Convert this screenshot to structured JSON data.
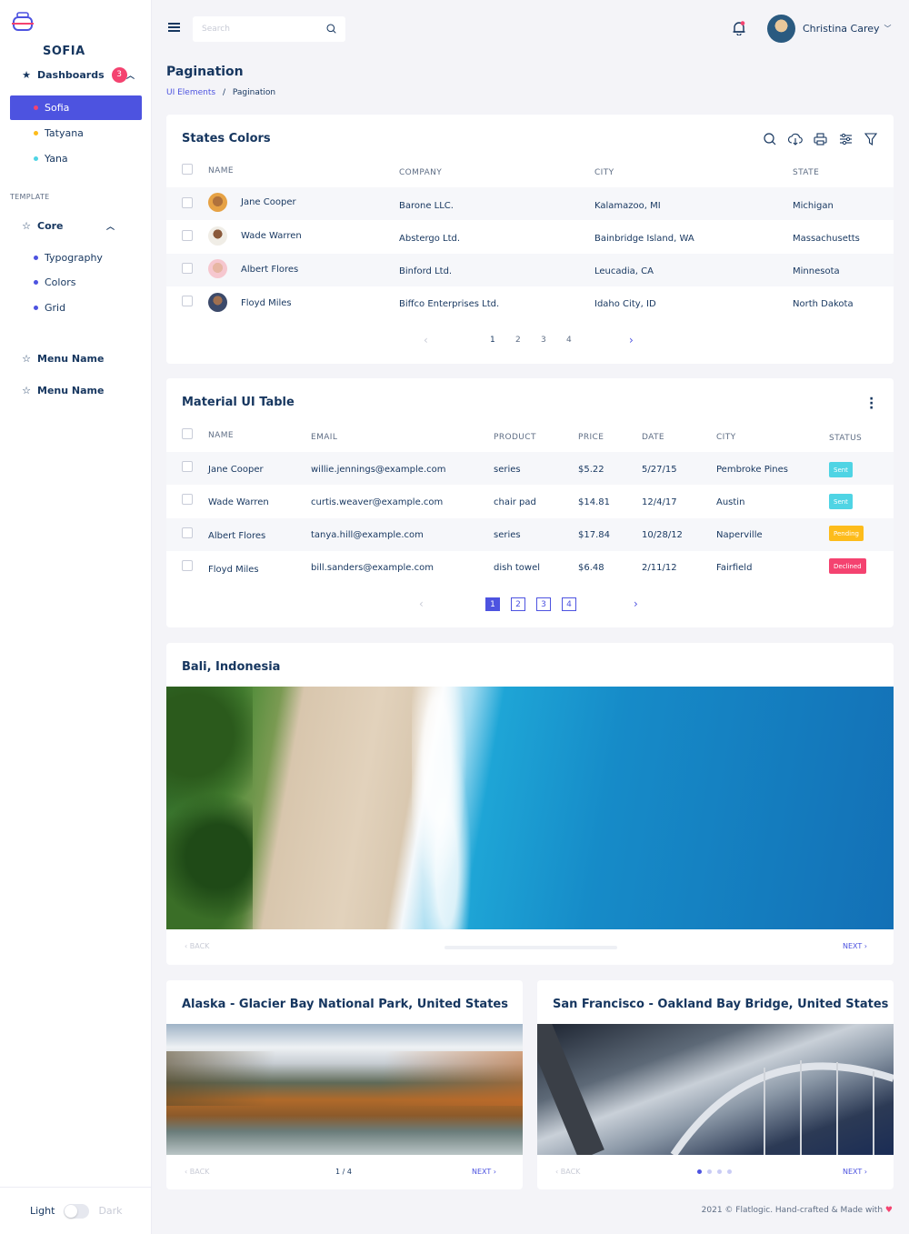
{
  "sidebar": {
    "brand": "SOFIA",
    "dashboards_label": "Dashboards",
    "dashboards_badge": "3",
    "dashboards_items": [
      {
        "label": "Sofia",
        "dot": "#f44370"
      },
      {
        "label": "Tatyana",
        "dot": "#fdbc1b"
      },
      {
        "label": "Yana",
        "dot": "#4fd4e4"
      }
    ],
    "template_label": "TEMPLATE",
    "core_label": "Core",
    "core_items": [
      {
        "label": "Typography",
        "dot": "#4d53e0"
      },
      {
        "label": "Colors",
        "dot": "#4d53e0"
      },
      {
        "label": "Grid",
        "dot": "#4d53e0"
      }
    ],
    "menu_items": [
      "Menu Name",
      "Menu Name"
    ],
    "theme_light": "Light",
    "theme_dark": "Dark"
  },
  "header": {
    "search_placeholder": "Search",
    "user_name": "Christina Carey"
  },
  "page": {
    "title": "Pagination",
    "breadcrumb_parent": "UI Elements",
    "breadcrumb_sep": "/",
    "breadcrumb_current": "Pagination"
  },
  "states_table": {
    "title": "States Colors",
    "columns": [
      "NAME",
      "COMPANY",
      "CITY",
      "STATE"
    ],
    "rows": [
      {
        "name": "Jane Cooper",
        "company": "Barone LLC.",
        "city": "Kalamazoo, MI",
        "state": "Michigan"
      },
      {
        "name": "Wade Warren",
        "company": "Abstergo Ltd.",
        "city": "Bainbridge Island, WA",
        "state": "Massachusetts"
      },
      {
        "name": "Albert Flores",
        "company": "Binford Ltd.",
        "city": "Leucadia, CA",
        "state": "Minnesota"
      },
      {
        "name": "Floyd Miles",
        "company": "Biffco Enterprises Ltd.",
        "city": "Idaho City, ID",
        "state": "North Dakota"
      }
    ],
    "pages": [
      "1",
      "2",
      "3",
      "4"
    ]
  },
  "material_table": {
    "title": "Material UI Table",
    "columns": [
      "NAME",
      "EMAIL",
      "PRODUCT",
      "PRICE",
      "DATE",
      "CITY",
      "STATUS"
    ],
    "rows": [
      {
        "name": "Jane Cooper",
        "email": "willie.jennings@example.com",
        "product": "series",
        "price": "$5.22",
        "date": "5/27/15",
        "city": "Pembroke Pines",
        "status": "Sent",
        "status_color": "#4fd4e4"
      },
      {
        "name": "Wade Warren",
        "email": "curtis.weaver@example.com",
        "product": "chair pad",
        "price": "$14.81",
        "date": "12/4/17",
        "city": "Austin",
        "status": "Sent",
        "status_color": "#4fd4e4"
      },
      {
        "name": "Albert Flores",
        "email": "tanya.hill@example.com",
        "product": "series",
        "price": "$17.84",
        "date": "10/28/12",
        "city": "Naperville",
        "status": "Pending",
        "status_color": "#fdbc1b"
      },
      {
        "name": "Floyd Miles",
        "email": "bill.sanders@example.com",
        "product": "dish towel",
        "price": "$6.48",
        "date": "2/11/12",
        "city": "Fairfield",
        "status": "Declined",
        "status_color": "#f44370"
      }
    ],
    "pages": [
      "1",
      "2",
      "3",
      "4"
    ]
  },
  "carousels": {
    "bali": {
      "title": "Bali, Indonesia",
      "back": "BACK",
      "next": "NEXT"
    },
    "alaska": {
      "title": "Alaska - Glacier Bay National Park, United States",
      "back": "BACK",
      "next": "NEXT",
      "counter": "1 / 4"
    },
    "sf": {
      "title": "San Francisco - Oakland Bay Bridge, United States",
      "back": "BACK",
      "next": "NEXT"
    }
  },
  "footer": {
    "text": "2021 © Flatlogic. Hand-crafted & Made with"
  },
  "colors": {
    "primary": "#4d53e0",
    "navy": "#16365f",
    "sent": "#4fd4e4",
    "pending": "#fdbc1b",
    "declined": "#f44370"
  }
}
